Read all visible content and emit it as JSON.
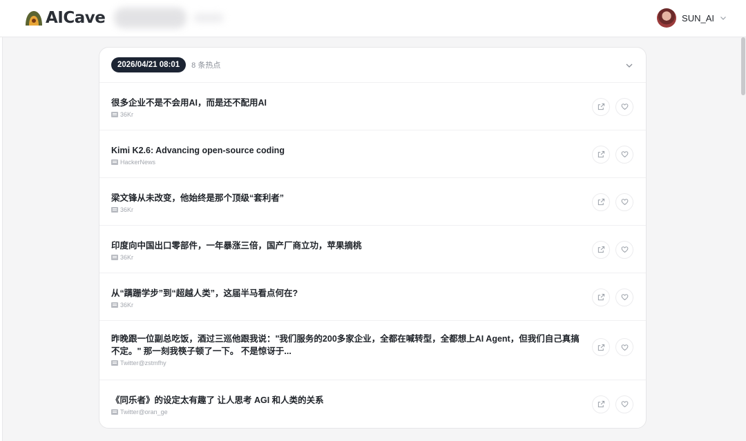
{
  "app": {
    "logo_text": "AICave"
  },
  "user": {
    "name": "SUN_AI"
  },
  "colors": {
    "pill_bg": "#1c2433",
    "logo_mark": "#5a5f2a"
  },
  "feed": {
    "date": "2026/04/21 08:01",
    "count_label": "8 条热点",
    "items": [
      {
        "title": "很多企业不是不会用AI，而是还不配用AI",
        "source": "36Kr"
      },
      {
        "title": "Kimi K2.6: Advancing open-source coding",
        "source": "HackerNews"
      },
      {
        "title": "梁文锋从未改变，他始终是那个顶级“套利者”",
        "source": "36Kr"
      },
      {
        "title": "印度向中国出口零部件，一年暴涨三倍，国产厂商立功，苹果摘桃",
        "source": "36Kr"
      },
      {
        "title": "从“蹒跚学步”到“超越人类”，这届半马看点何在?",
        "source": "36Kr"
      },
      {
        "title": "昨晚跟一位副总吃饭，酒过三巡他跟我说：\"我们服务的200多家企业，全都在喊转型，全都想上AI Agent，但我们自己真搞不定。\" 那一刻我筷子顿了一下。 不是惊讶于...",
        "source": "Twitter@zstmfhy"
      },
      {
        "title": "《同乐者》的设定太有趣了 让人思考 AGI 和人类的关系",
        "source": "Twitter@oran_ge"
      }
    ]
  }
}
